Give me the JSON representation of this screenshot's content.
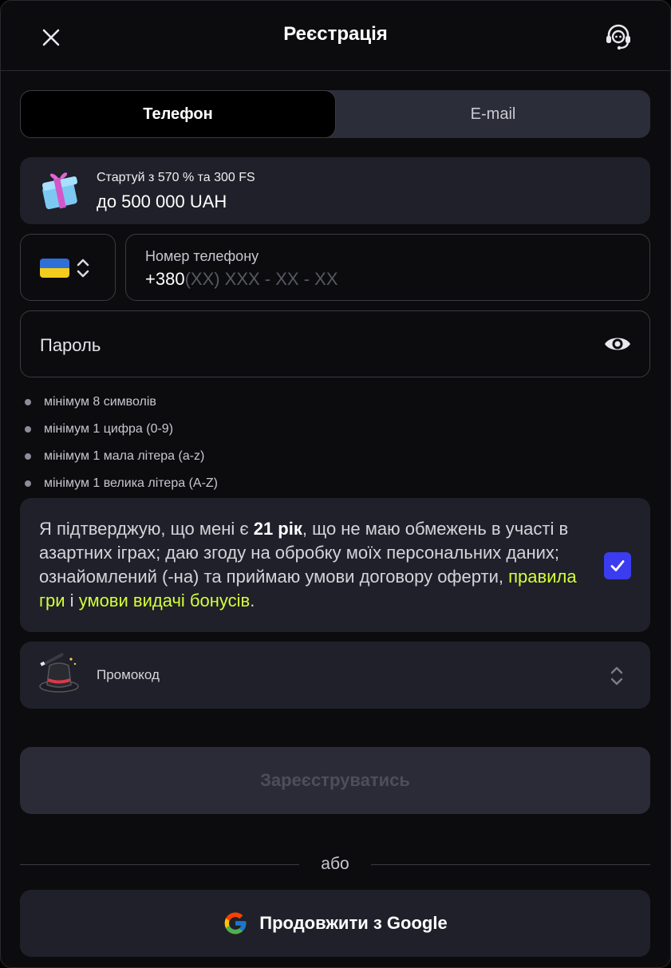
{
  "header": {
    "title": "Реєстрація",
    "close_icon": "close-icon",
    "support_icon": "support-headset-icon"
  },
  "tabs": [
    {
      "label": "Телефон",
      "active": true
    },
    {
      "label": "E-mail",
      "active": false
    }
  ],
  "bonus": {
    "icon": "gift-icon",
    "line1": "Стартуй з 570 % та 300 FS",
    "line2": "до 500 000 UAH"
  },
  "phone": {
    "country_flag": "ukraine-flag-icon",
    "label": "Номер телефону",
    "prefix": "+380",
    "mask": "(XX) XXX - XX - XX"
  },
  "password": {
    "placeholder": "Пароль",
    "toggle_icon": "eye-icon"
  },
  "password_rules": [
    "мінімум 8 символів",
    "мінімум 1 цифра (0-9)",
    "мінімум 1 мала літера (a-z)",
    "мінімум 1 велика літера (A-Z)"
  ],
  "agreement": {
    "part1": "Я підтверджую, що мені є ",
    "age": "21 рік",
    "part2": ", що не маю обмежень в участі в азартних іграх; даю згоду на обробку моїх персональних даних; ознайомлений (-на) та приймаю умови договору оферти, ",
    "link1": "правила гри",
    "part3": " і ",
    "link2": "умови видачі бонусів",
    "part4": ".",
    "checked": true,
    "accent_color": "#3b3cf0",
    "link_color": "#d4ff3a"
  },
  "promo": {
    "icon": "magic-hat-icon",
    "label": "Промокод"
  },
  "register_button": "Зареєструватись",
  "divider_text": "або",
  "google_button": "Продовжити з Google"
}
